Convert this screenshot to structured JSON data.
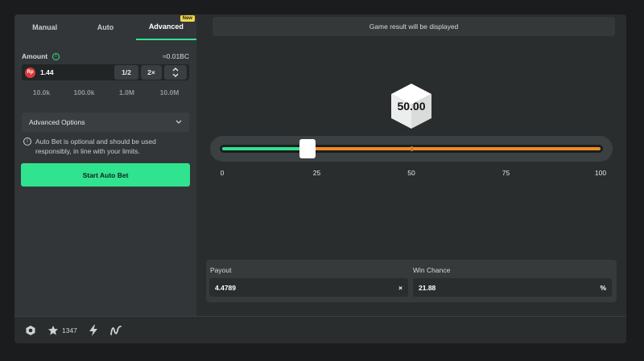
{
  "tabs": [
    {
      "label": "Manual"
    },
    {
      "label": "Auto"
    },
    {
      "label": "Advanced",
      "badge": "New"
    }
  ],
  "amount": {
    "label": "Amount",
    "approx": "≈0.01BC",
    "currency_badge": "Rp",
    "value": "1.44",
    "half_label": "1/2",
    "double_label": "2×"
  },
  "quick_amounts": [
    "10.0k",
    "100.0k",
    "1.0M",
    "10.0M"
  ],
  "advanced_options": {
    "label": "Advanced Options"
  },
  "notice": "Auto Bet is optional and should be used responsibly, in line with your limits.",
  "start_button": "Start Auto Bet",
  "result_bar": "Game result will be displayed",
  "dice": {
    "value": "50.00"
  },
  "slider": {
    "min": 0,
    "max": 100,
    "thumb_value": 22.5,
    "midpoint": 50,
    "ticks": [
      "0",
      "25",
      "50",
      "75",
      "100"
    ],
    "left_color": "#2fe38f",
    "right_color": "#f28b24"
  },
  "payout": {
    "label": "Payout",
    "value": "4.4789",
    "suffix": "×"
  },
  "win_chance": {
    "label": "Win Chance",
    "value": "21.88",
    "suffix": "%"
  },
  "footer": {
    "star_count": "1347"
  },
  "colors": {
    "accent": "#2fe38f",
    "orange": "#f28b24"
  }
}
